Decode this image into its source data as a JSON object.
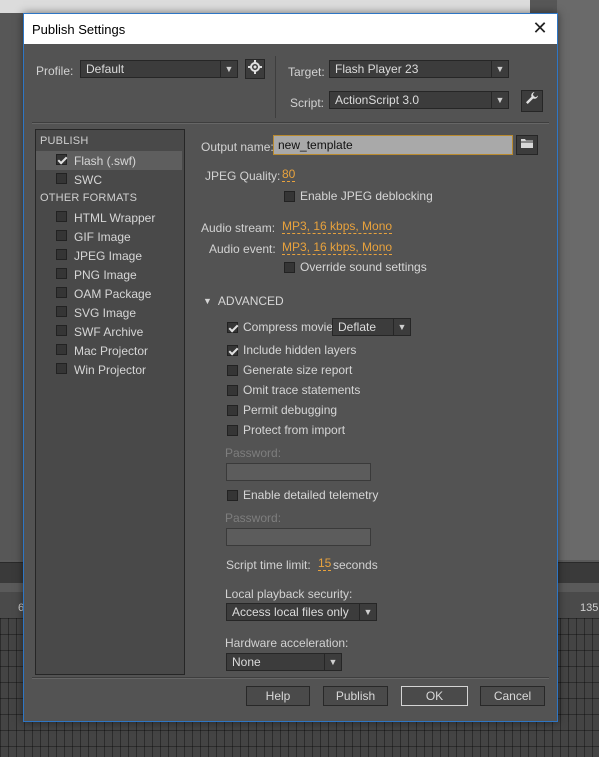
{
  "dialog": {
    "title": "Publish Settings"
  },
  "top": {
    "profile_label": "Profile:",
    "profile_value": "Default",
    "target_label": "Target:",
    "target_value": "Flash Player 23",
    "script_label": "Script:",
    "script_value": "ActionScript 3.0"
  },
  "formats": {
    "publish_header": "PUBLISH",
    "publish_items": [
      {
        "label": "Flash (.swf)",
        "checked": true
      },
      {
        "label": "SWC",
        "checked": false
      }
    ],
    "other_header": "OTHER FORMATS",
    "other_items": [
      {
        "label": "HTML Wrapper",
        "checked": false
      },
      {
        "label": "GIF Image",
        "checked": false
      },
      {
        "label": "JPEG Image",
        "checked": false
      },
      {
        "label": "PNG Image",
        "checked": false
      },
      {
        "label": "OAM Package",
        "checked": false
      },
      {
        "label": "SVG Image",
        "checked": false
      },
      {
        "label": "SWF Archive",
        "checked": false
      },
      {
        "label": "Mac Projector",
        "checked": false
      },
      {
        "label": "Win Projector",
        "checked": false
      }
    ]
  },
  "settings": {
    "output_label": "Output name:",
    "output_value": "new_template",
    "jpeg_quality_label": "JPEG Quality:",
    "jpeg_quality_value": "80",
    "jpeg_deblocking_label": "Enable JPEG deblocking",
    "audio_stream_label": "Audio stream:",
    "audio_stream_value": "MP3, 16 kbps, Mono",
    "audio_event_label": "Audio event:",
    "audio_event_value": "MP3, 16 kbps, Mono",
    "override_sound_label": "Override sound settings",
    "advanced_label": "ADVANCED",
    "compress_label": "Compress movie",
    "compress_value": "Deflate",
    "include_hidden_label": "Include hidden layers",
    "size_report_label": "Generate size report",
    "omit_trace_label": "Omit trace statements",
    "permit_debug_label": "Permit debugging",
    "protect_import_label": "Protect from import",
    "password_label_1": "Password:",
    "telemetry_label": "Enable detailed telemetry",
    "password_label_2": "Password:",
    "script_time_label": "Script time limit:",
    "script_time_value": "15",
    "script_time_unit": "seconds",
    "local_security_label": "Local playback security:",
    "local_security_value": "Access local files only",
    "hw_accel_label": "Hardware acceleration:",
    "hw_accel_value": "None"
  },
  "buttons": {
    "help": "Help",
    "publish": "Publish",
    "ok": "OK",
    "cancel": "Cancel"
  },
  "timeline": {
    "frame_left": "6",
    "frame_right": "135"
  }
}
